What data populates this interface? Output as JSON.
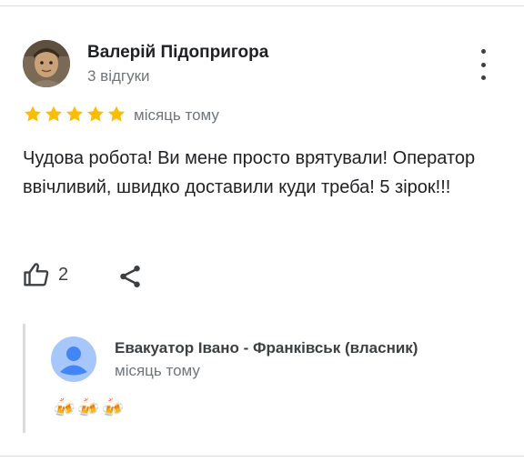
{
  "review": {
    "author_name": "Валерій Підопригора",
    "review_count": "3 відгуки",
    "rating": 5,
    "date": "місяць тому",
    "text": "Чудова робота! Ви мене просто врятували! Оператор ввічливий, швидко доставили куди треба! 5 зірок!!!",
    "like_count": "2",
    "icons": {
      "more": "more-vert-icon",
      "like": "thumb-up-icon",
      "share": "share-icon"
    }
  },
  "owner_reply": {
    "name": "Евакуатор Івано - Франківськ (власник)",
    "date": "місяць тому",
    "text": "🍻🍻🍻"
  },
  "colors": {
    "star": "#fbbc04",
    "avatar_placeholder": "#4285f4",
    "secondary_text": "#70757a"
  }
}
